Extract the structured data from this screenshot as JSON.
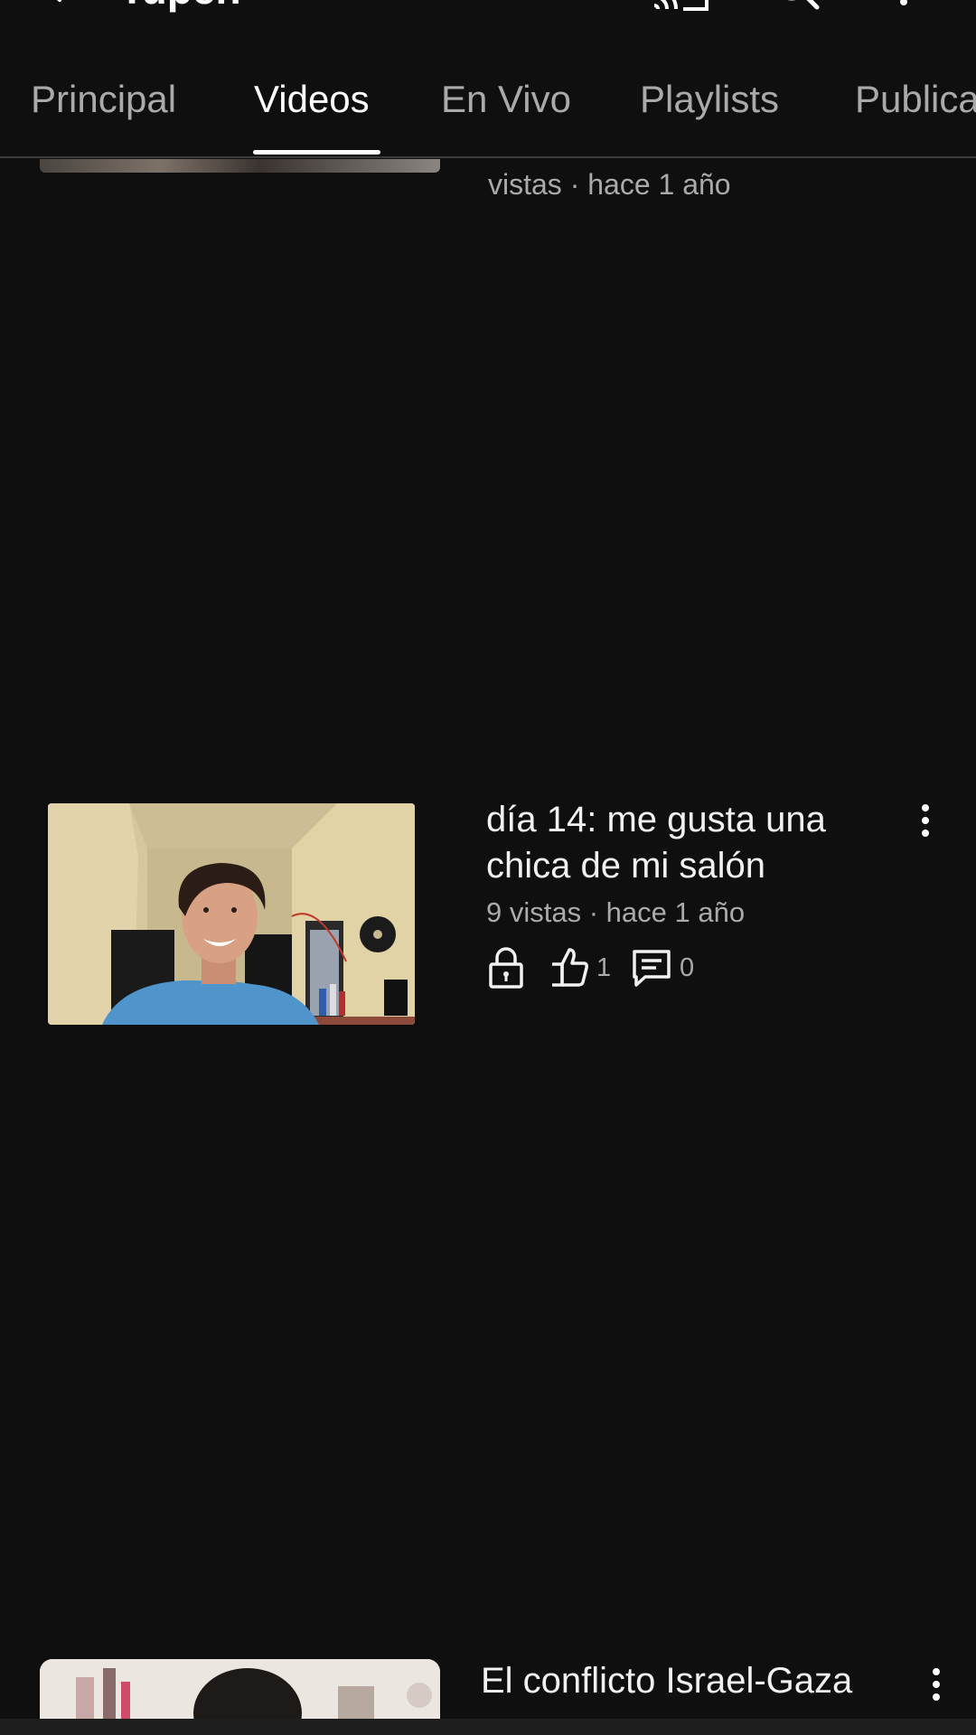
{
  "header": {
    "channel_title": "Tupen",
    "icons": [
      "back-icon",
      "cast-icon",
      "search-icon",
      "more-vert-icon"
    ]
  },
  "tabs": [
    {
      "label": "Principal",
      "active": false
    },
    {
      "label": "Videos",
      "active": true
    },
    {
      "label": "En Vivo",
      "active": false
    },
    {
      "label": "Playlists",
      "active": false
    },
    {
      "label": "Publica",
      "active": false
    }
  ],
  "previous_item": {
    "meta": "vistas · hace 1 año"
  },
  "video": {
    "title": "día 14: me gusta una chica de mi salón",
    "meta": "9 vistas · hace 1 año",
    "visibility_icon": "lock-icon",
    "likes": "1",
    "comments": "0"
  },
  "next_item": {
    "title": "El conflicto Israel-Gaza"
  },
  "colors": {
    "background": "#0f0f0f",
    "primary_text": "#f1f1f1",
    "secondary_text": "#aaaaaa",
    "divider": "#3a3a3a"
  }
}
